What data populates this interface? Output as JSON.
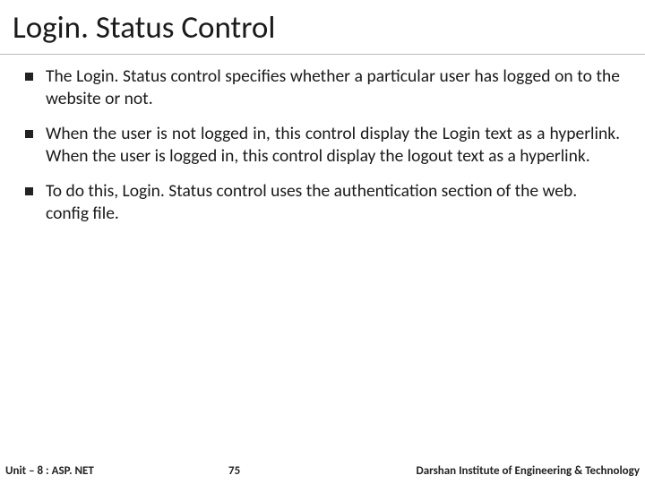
{
  "title": "Login. Status Control",
  "bullets": [
    "The Login. Status control specifies whether a particular user has logged on to the website or not.",
    "When the user is not logged in, this control display the Login text as a hyperlink. When the user is logged in, this control display the logout text as a hyperlink.",
    "To do this, Login. Status control uses the authentication section of the web. config file."
  ],
  "footer": {
    "unit": "Unit – 8 : ASP. NET",
    "page": "75",
    "institute": "Darshan Institute of Engineering & Technology"
  }
}
